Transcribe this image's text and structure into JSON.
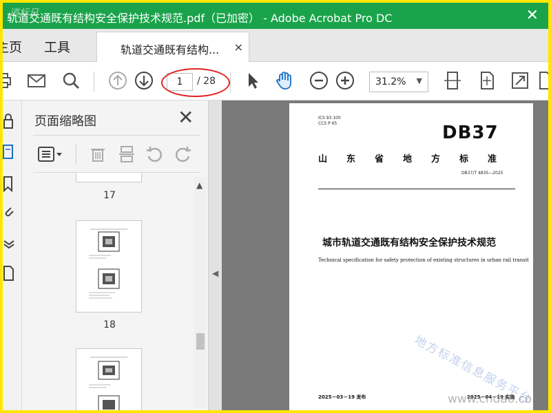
{
  "window": {
    "title": "轨道交通既有结构安全保护技术规范.pdf（已加密） - Adobe Acrobat Pro DC",
    "close_glyph": "✕",
    "logo_text": "道标日"
  },
  "menu": {
    "home": "主页",
    "tools": "工具"
  },
  "tab": {
    "label": "轨道交通既有结构...",
    "close_glyph": "×"
  },
  "toolbar": {
    "page_current": "1",
    "page_total": "/ 28",
    "zoom": "31.2%",
    "zoom_caret": "▼"
  },
  "thumbnails": {
    "title": "页面缩略图",
    "close_glyph": "✕",
    "labels": [
      "17",
      "18"
    ],
    "scroll_up": "▲"
  },
  "collapse_arrow": "◀",
  "document": {
    "ics": "ICS  93.100",
    "ccs": "CCS  P  65",
    "db": "DB37",
    "level": "山东省地方标准",
    "number": "DB37/T  4835—2025",
    "title_cn": "城市轨道交通既有结构安全保护技术规范",
    "title_en": "Technical specification for safety protection of existing structures in urban rail transit",
    "pub_date": "2025－03－19 发布",
    "impl_date": "2025－04－19 实施",
    "watermark": "地方标准信息服务平台"
  },
  "site_mark": "www.cndao.co",
  "colors": {
    "titlebar": "#1aa34a",
    "frame": "#ffe600",
    "highlight_oval": "#e02222",
    "doc_bg": "#7a7a7a"
  }
}
